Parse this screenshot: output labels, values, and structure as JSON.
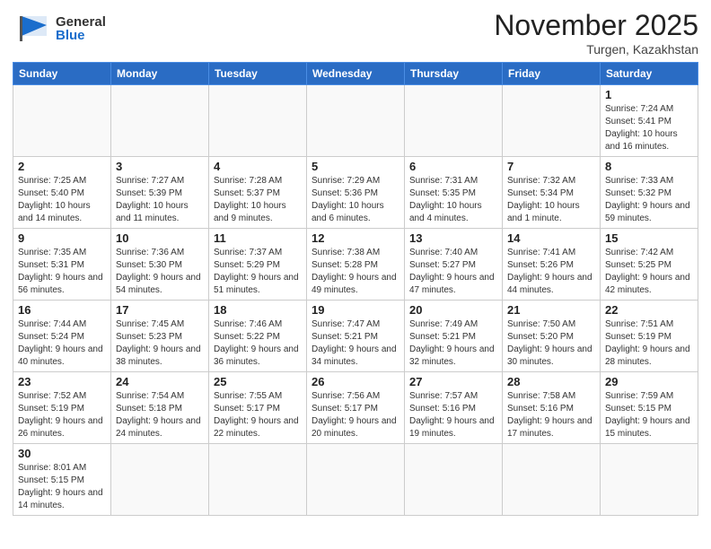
{
  "header": {
    "logo_general": "General",
    "logo_blue": "Blue",
    "month_title": "November 2025",
    "location": "Turgen, Kazakhstan"
  },
  "weekdays": [
    "Sunday",
    "Monday",
    "Tuesday",
    "Wednesday",
    "Thursday",
    "Friday",
    "Saturday"
  ],
  "weeks": [
    [
      {
        "day": "",
        "info": ""
      },
      {
        "day": "",
        "info": ""
      },
      {
        "day": "",
        "info": ""
      },
      {
        "day": "",
        "info": ""
      },
      {
        "day": "",
        "info": ""
      },
      {
        "day": "",
        "info": ""
      },
      {
        "day": "1",
        "info": "Sunrise: 7:24 AM\nSunset: 5:41 PM\nDaylight: 10 hours and 16 minutes."
      }
    ],
    [
      {
        "day": "2",
        "info": "Sunrise: 7:25 AM\nSunset: 5:40 PM\nDaylight: 10 hours and 14 minutes."
      },
      {
        "day": "3",
        "info": "Sunrise: 7:27 AM\nSunset: 5:39 PM\nDaylight: 10 hours and 11 minutes."
      },
      {
        "day": "4",
        "info": "Sunrise: 7:28 AM\nSunset: 5:37 PM\nDaylight: 10 hours and 9 minutes."
      },
      {
        "day": "5",
        "info": "Sunrise: 7:29 AM\nSunset: 5:36 PM\nDaylight: 10 hours and 6 minutes."
      },
      {
        "day": "6",
        "info": "Sunrise: 7:31 AM\nSunset: 5:35 PM\nDaylight: 10 hours and 4 minutes."
      },
      {
        "day": "7",
        "info": "Sunrise: 7:32 AM\nSunset: 5:34 PM\nDaylight: 10 hours and 1 minute."
      },
      {
        "day": "8",
        "info": "Sunrise: 7:33 AM\nSunset: 5:32 PM\nDaylight: 9 hours and 59 minutes."
      }
    ],
    [
      {
        "day": "9",
        "info": "Sunrise: 7:35 AM\nSunset: 5:31 PM\nDaylight: 9 hours and 56 minutes."
      },
      {
        "day": "10",
        "info": "Sunrise: 7:36 AM\nSunset: 5:30 PM\nDaylight: 9 hours and 54 minutes."
      },
      {
        "day": "11",
        "info": "Sunrise: 7:37 AM\nSunset: 5:29 PM\nDaylight: 9 hours and 51 minutes."
      },
      {
        "day": "12",
        "info": "Sunrise: 7:38 AM\nSunset: 5:28 PM\nDaylight: 9 hours and 49 minutes."
      },
      {
        "day": "13",
        "info": "Sunrise: 7:40 AM\nSunset: 5:27 PM\nDaylight: 9 hours and 47 minutes."
      },
      {
        "day": "14",
        "info": "Sunrise: 7:41 AM\nSunset: 5:26 PM\nDaylight: 9 hours and 44 minutes."
      },
      {
        "day": "15",
        "info": "Sunrise: 7:42 AM\nSunset: 5:25 PM\nDaylight: 9 hours and 42 minutes."
      }
    ],
    [
      {
        "day": "16",
        "info": "Sunrise: 7:44 AM\nSunset: 5:24 PM\nDaylight: 9 hours and 40 minutes."
      },
      {
        "day": "17",
        "info": "Sunrise: 7:45 AM\nSunset: 5:23 PM\nDaylight: 9 hours and 38 minutes."
      },
      {
        "day": "18",
        "info": "Sunrise: 7:46 AM\nSunset: 5:22 PM\nDaylight: 9 hours and 36 minutes."
      },
      {
        "day": "19",
        "info": "Sunrise: 7:47 AM\nSunset: 5:21 PM\nDaylight: 9 hours and 34 minutes."
      },
      {
        "day": "20",
        "info": "Sunrise: 7:49 AM\nSunset: 5:21 PM\nDaylight: 9 hours and 32 minutes."
      },
      {
        "day": "21",
        "info": "Sunrise: 7:50 AM\nSunset: 5:20 PM\nDaylight: 9 hours and 30 minutes."
      },
      {
        "day": "22",
        "info": "Sunrise: 7:51 AM\nSunset: 5:19 PM\nDaylight: 9 hours and 28 minutes."
      }
    ],
    [
      {
        "day": "23",
        "info": "Sunrise: 7:52 AM\nSunset: 5:19 PM\nDaylight: 9 hours and 26 minutes."
      },
      {
        "day": "24",
        "info": "Sunrise: 7:54 AM\nSunset: 5:18 PM\nDaylight: 9 hours and 24 minutes."
      },
      {
        "day": "25",
        "info": "Sunrise: 7:55 AM\nSunset: 5:17 PM\nDaylight: 9 hours and 22 minutes."
      },
      {
        "day": "26",
        "info": "Sunrise: 7:56 AM\nSunset: 5:17 PM\nDaylight: 9 hours and 20 minutes."
      },
      {
        "day": "27",
        "info": "Sunrise: 7:57 AM\nSunset: 5:16 PM\nDaylight: 9 hours and 19 minutes."
      },
      {
        "day": "28",
        "info": "Sunrise: 7:58 AM\nSunset: 5:16 PM\nDaylight: 9 hours and 17 minutes."
      },
      {
        "day": "29",
        "info": "Sunrise: 7:59 AM\nSunset: 5:15 PM\nDaylight: 9 hours and 15 minutes."
      }
    ],
    [
      {
        "day": "30",
        "info": "Sunrise: 8:01 AM\nSunset: 5:15 PM\nDaylight: 9 hours and 14 minutes."
      },
      {
        "day": "",
        "info": ""
      },
      {
        "day": "",
        "info": ""
      },
      {
        "day": "",
        "info": ""
      },
      {
        "day": "",
        "info": ""
      },
      {
        "day": "",
        "info": ""
      },
      {
        "day": "",
        "info": ""
      }
    ]
  ]
}
